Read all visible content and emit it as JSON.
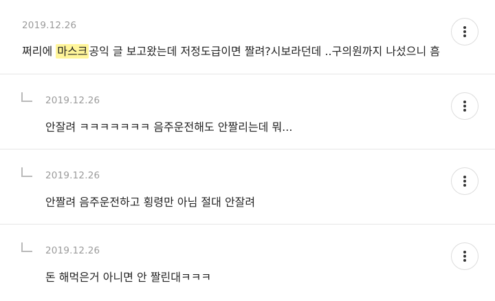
{
  "comments": [
    {
      "date": "2019.12.26",
      "text_before": "쩌리에 ",
      "highlight": "마스크",
      "text_after": "공익 글 보고왔는데 저정도급이면 짤려?시보라던데 ..구의원까지 나섰으니 흠",
      "is_reply": false
    },
    {
      "date": "2019.12.26",
      "text": "안잘려 ㅋㅋㅋㅋㅋㅋㅋ 음주운전해도 안짤리는데 뭐...",
      "is_reply": true
    },
    {
      "date": "2019.12.26",
      "text": "안짤려 음주운전하고 횡령만 아님 절대 안잘려",
      "is_reply": true
    },
    {
      "date": "2019.12.26",
      "text": "돈 해먹은거 아니면 안 짤린대ㅋㅋㅋ",
      "is_reply": true
    }
  ],
  "colors": {
    "highlight": "#fff59a",
    "date": "#9a9a9a",
    "text": "#222222",
    "divider": "#e6e6e6"
  },
  "icons": {
    "more": "more-vertical-icon",
    "reply": "reply-arrow-icon"
  }
}
